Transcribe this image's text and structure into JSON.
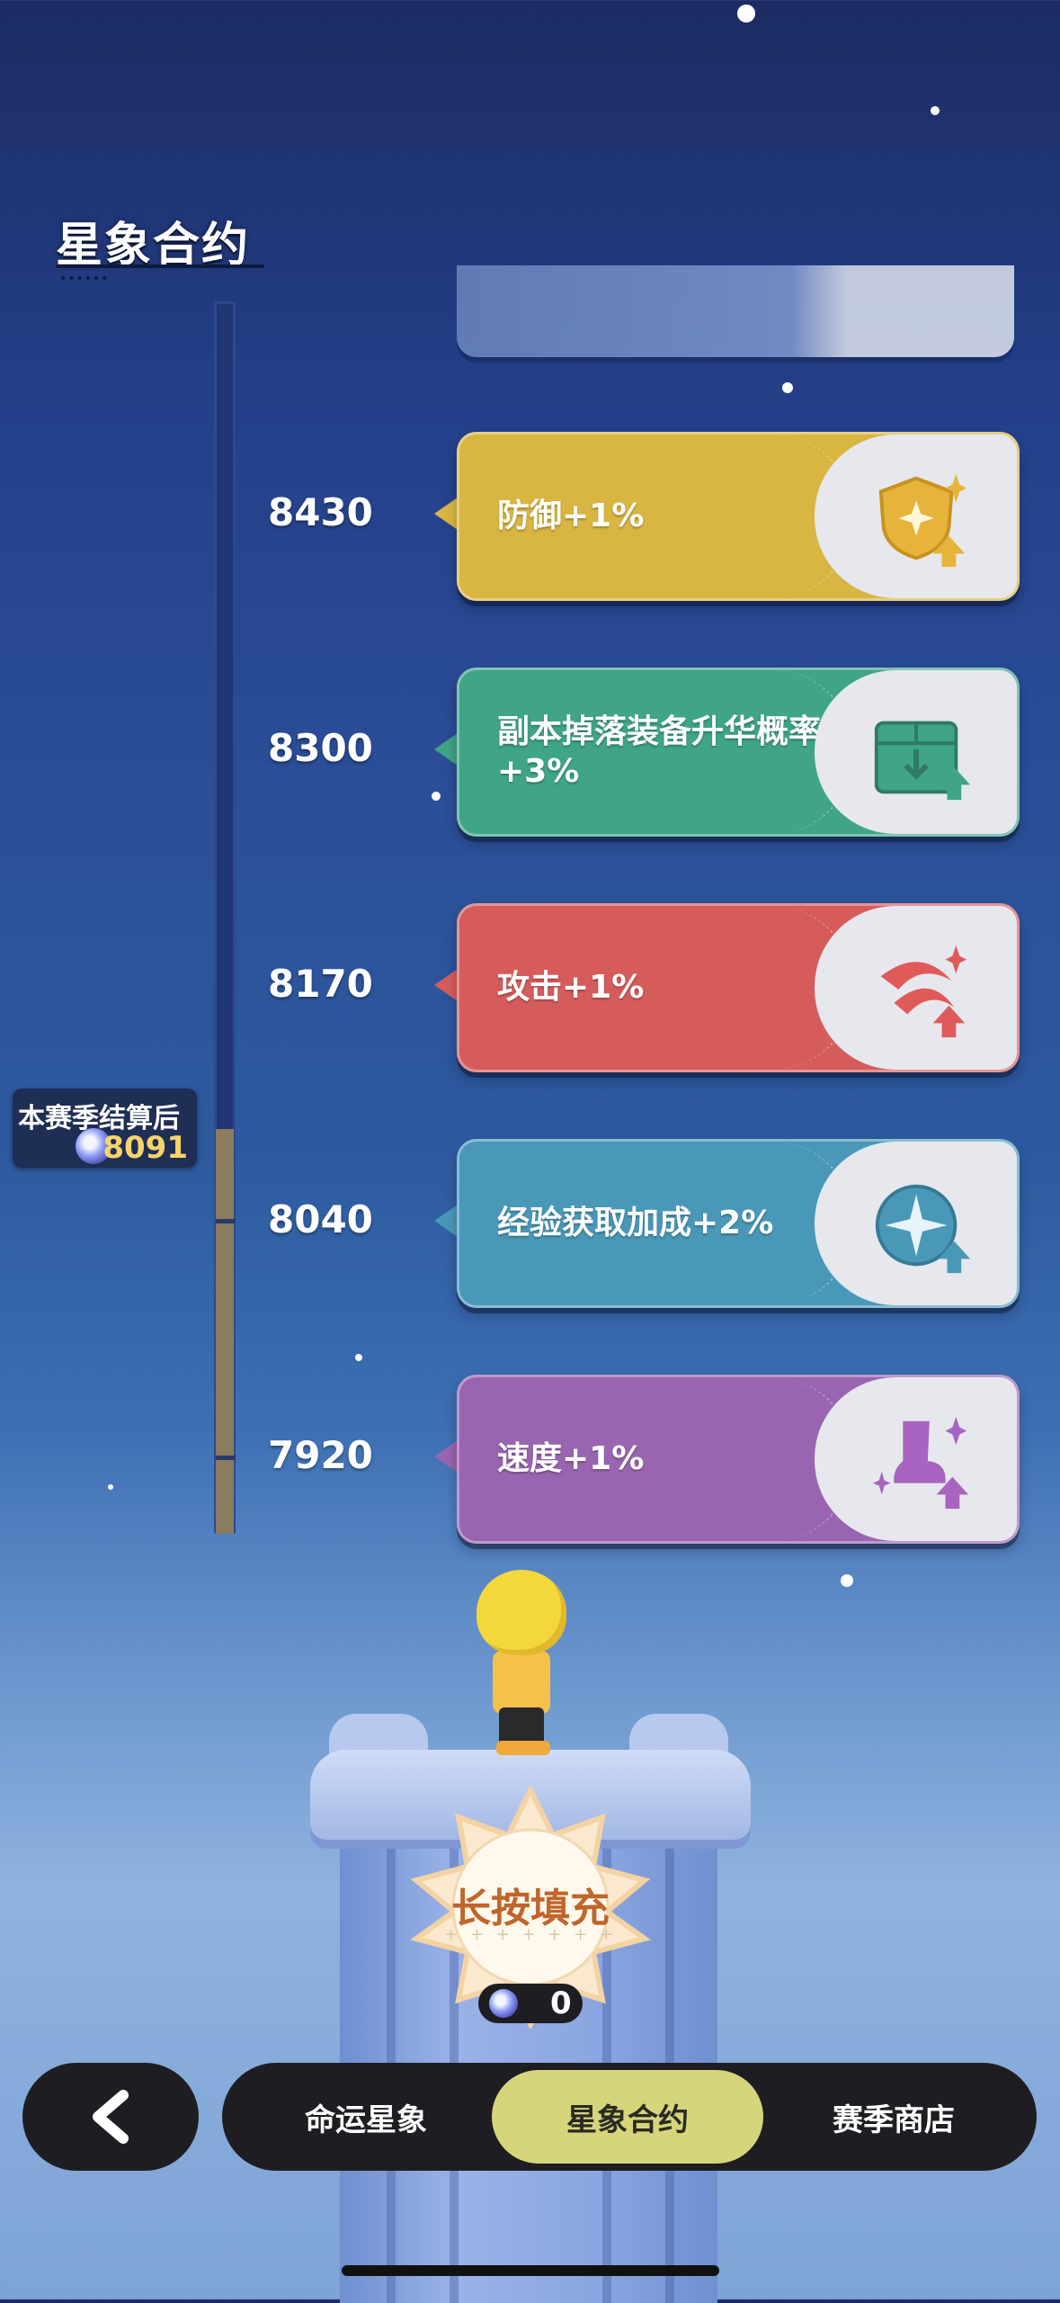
{
  "page": {
    "title": "星象合约"
  },
  "progress": {
    "marker_label": "本赛季结算后",
    "marker_value": "8091"
  },
  "tiers": [
    {
      "level": "8430",
      "reward": "防御+1%",
      "color": "#d9b541",
      "icon": "shield-icon"
    },
    {
      "level": "8300",
      "reward": "副本掉落装备升华概率+3%",
      "color": "#3fa488",
      "icon": "box-icon"
    },
    {
      "level": "8170",
      "reward": "攻击+1%",
      "color": "#d65c5c",
      "icon": "claw-icon"
    },
    {
      "level": "8040",
      "reward": "经验获取加成+2%",
      "color": "#4a98b8",
      "icon": "compass-icon"
    },
    {
      "level": "7920",
      "reward": "速度+1%",
      "color": "#9a65b0",
      "icon": "boot-icon"
    }
  ],
  "fill_button": {
    "label": "长按填充",
    "cost": "0"
  },
  "nav": {
    "tabs": [
      {
        "label": "命运星象",
        "active": false
      },
      {
        "label": "星象合约",
        "active": true
      },
      {
        "label": "赛季商店",
        "active": false
      }
    ]
  }
}
